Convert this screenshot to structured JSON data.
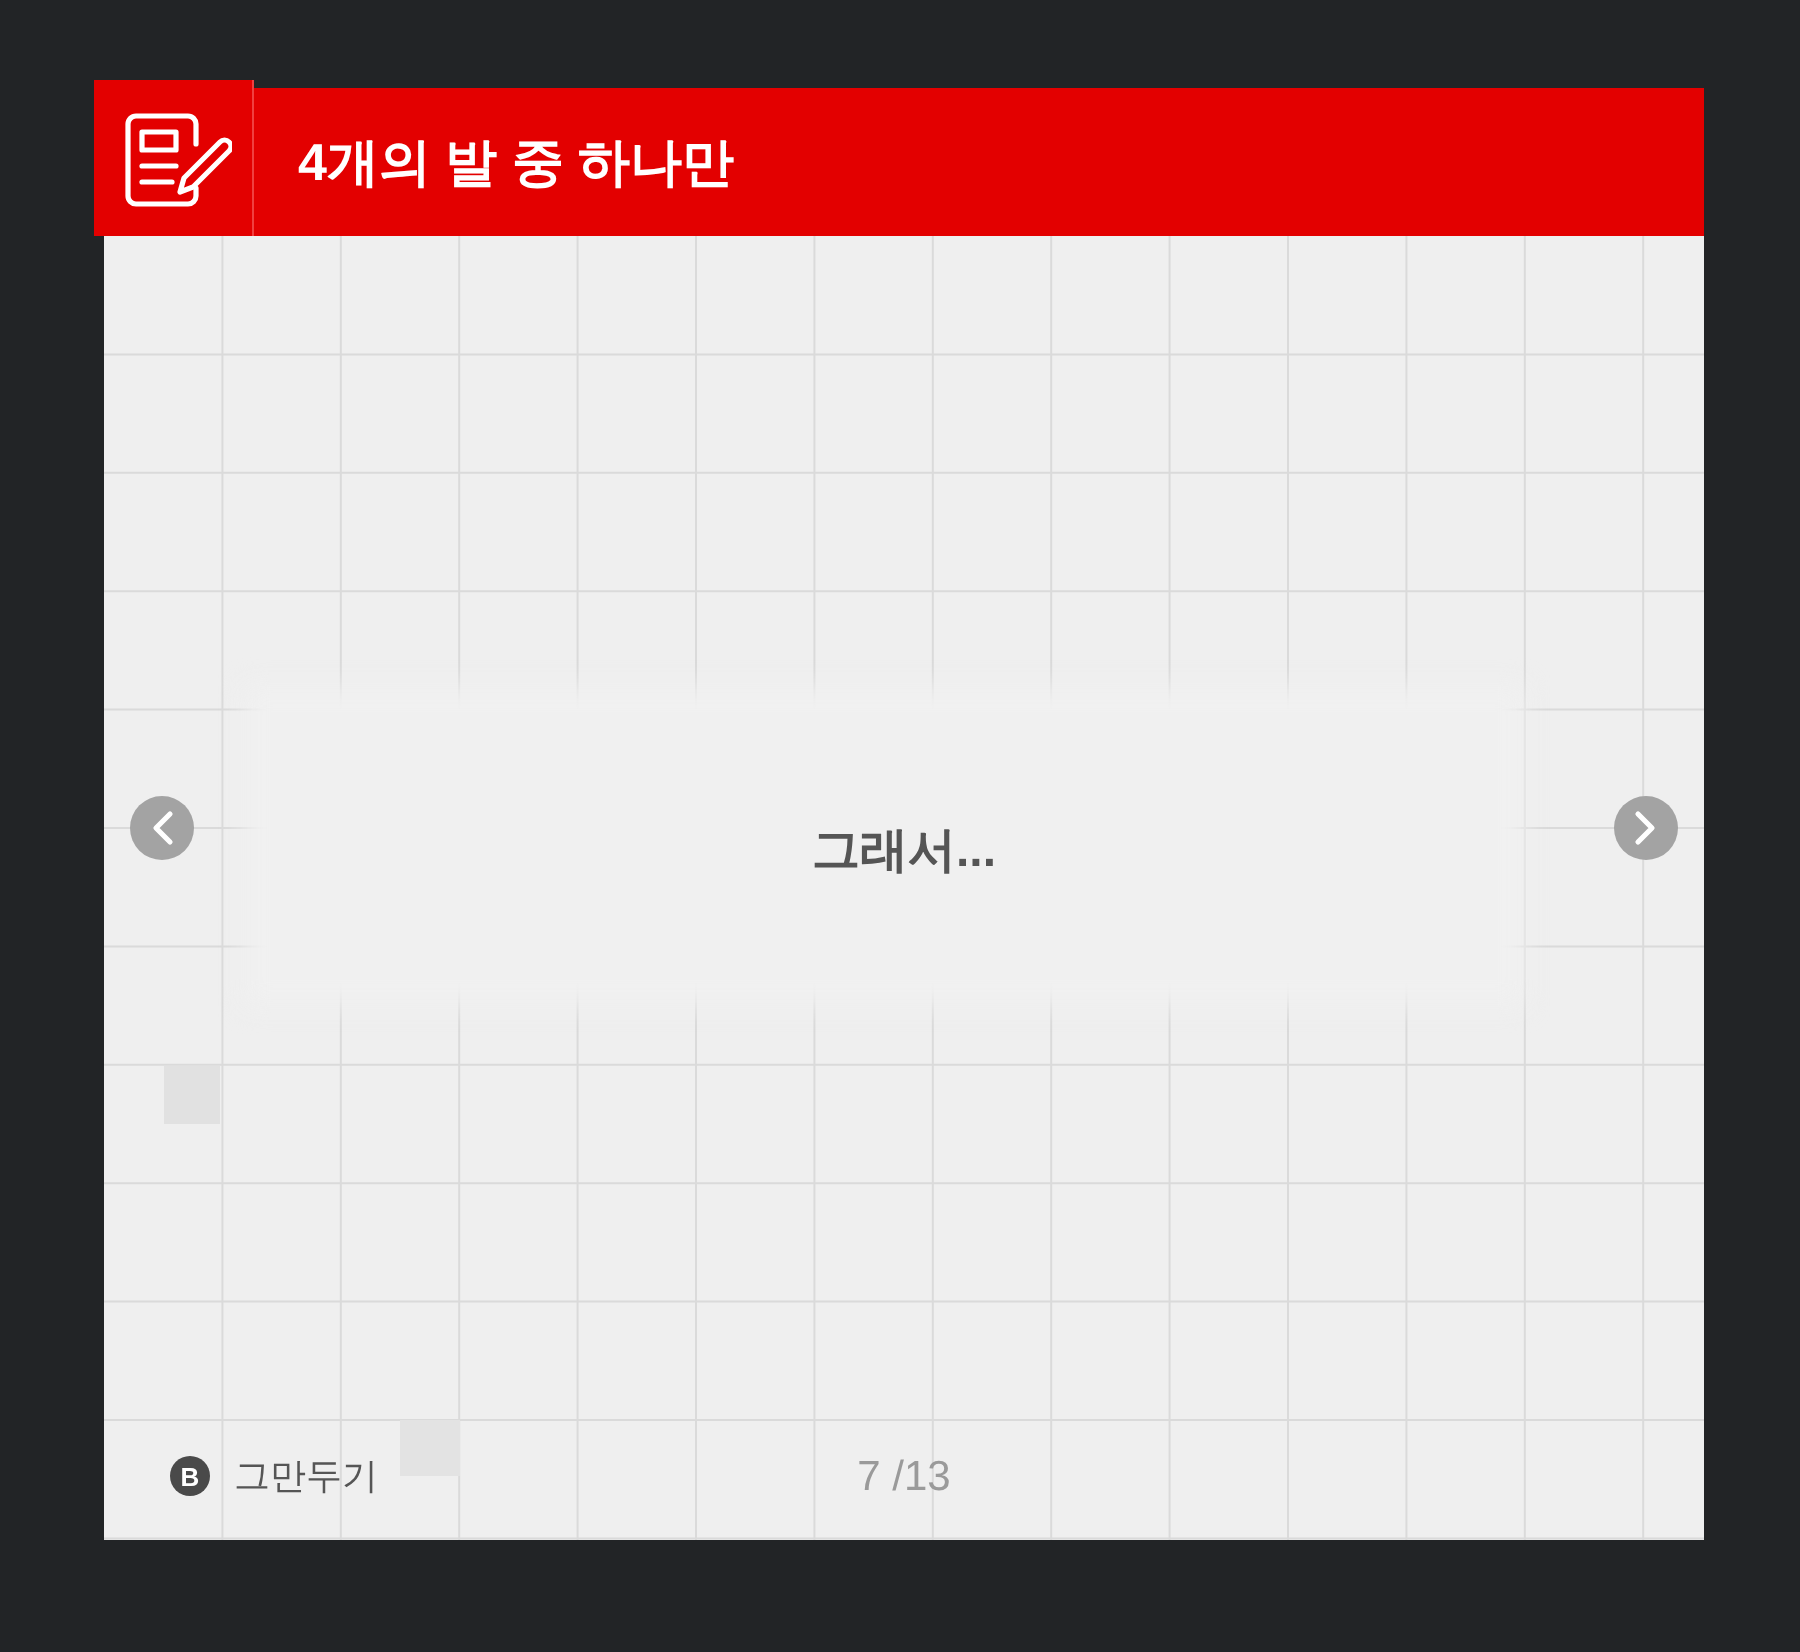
{
  "header": {
    "title": "4개의 발 중 하나만"
  },
  "slide": {
    "text": "그래서..."
  },
  "footer": {
    "quit_hint": {
      "key": "B",
      "label": "그만두기"
    },
    "page_indicator": "7 /13"
  }
}
